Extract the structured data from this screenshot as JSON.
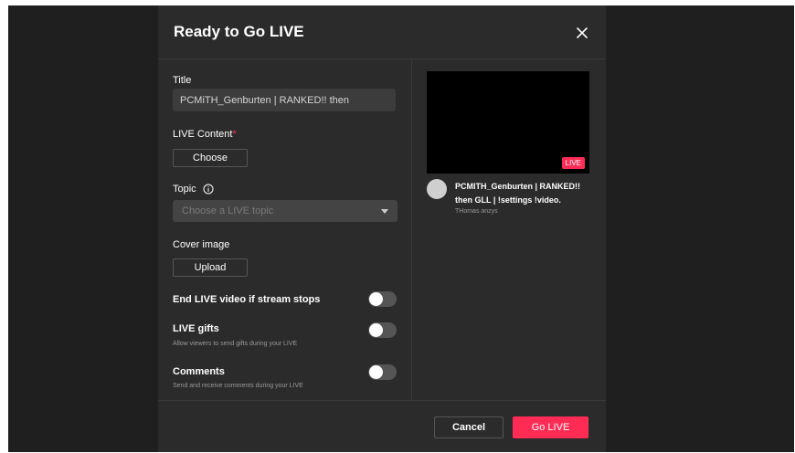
{
  "modal": {
    "title": "Ready to Go LIVE",
    "close_icon": "close-icon"
  },
  "form": {
    "title_label": "Title",
    "title_value": "PCMiTH_Genburten | RANKED!! then",
    "live_content_label": "LIVE Content",
    "live_content_required": "*",
    "choose_button": "Choose",
    "topic_label": "Topic",
    "topic_info_icon": "info-icon",
    "topic_placeholder": "Choose a LIVE topic",
    "cover_image_label": "Cover image",
    "upload_button": "Upload",
    "toggles": [
      {
        "label": "End LIVE video if stream stops",
        "sub": "",
        "on": false
      },
      {
        "label": "LIVE gifts",
        "sub": "Allow viewers to send gifts during your LIVE",
        "on": false
      },
      {
        "label": "Comments",
        "sub": "Send and receive comments during your LIVE",
        "on": false
      }
    ]
  },
  "preview": {
    "badge": "LIVE",
    "stream_title": "PCMITH_Genburten | RANKED!! then GLL | !settings !video.",
    "username": "THomas anzys"
  },
  "footer": {
    "cancel_label": "Cancel",
    "golive_label": "Go LIVE"
  },
  "colors": {
    "accent": "#fe2c55",
    "modal_bg": "#2b2b2b",
    "backdrop": "#1f1f1f"
  }
}
